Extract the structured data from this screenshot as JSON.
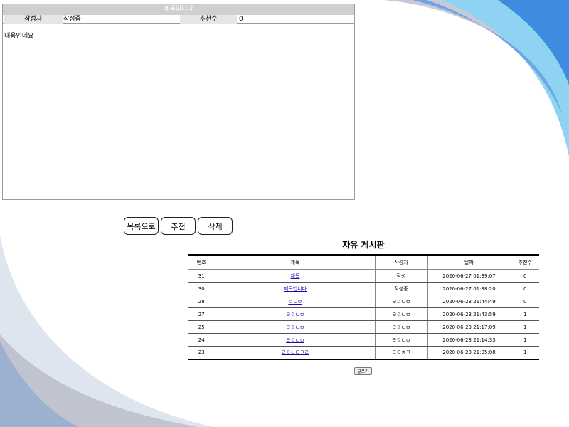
{
  "post": {
    "title": "제목입니다",
    "author_label": "작성자",
    "author": "작성중",
    "recommend_label": "추천수",
    "recommend_count": "0",
    "content": "내용인데요"
  },
  "actions": {
    "list": "목록으로",
    "recommend": "추천",
    "delete": "삭제"
  },
  "board": {
    "title": "자유 게시판",
    "headers": [
      "번호",
      "제목",
      "작성자",
      "날짜",
      "추천수"
    ],
    "rows": [
      {
        "no": "31",
        "title": "제목",
        "author": "작성",
        "date": "2020-06-27 01:39:07",
        "rec": "0"
      },
      {
        "no": "30",
        "title": "제목입니다",
        "author": "작성중",
        "date": "2020-06-27 01:38:20",
        "rec": "0"
      },
      {
        "no": "28",
        "title": "ㅇㄴㅁ",
        "author": "ㄹㅇㄴㅁ",
        "date": "2020-06-23 21:44:49",
        "rec": "0"
      },
      {
        "no": "27",
        "title": "ㄹㅇㄴㅁ",
        "author": "ㄹㅇㄴㅁ",
        "date": "2020-06-23 21:43:59",
        "rec": "1"
      },
      {
        "no": "25",
        "title": "ㄹㅇㄴㅁ",
        "author": "ㄹㅇㄴㅁ",
        "date": "2020-06-23 21:17:09",
        "rec": "1"
      },
      {
        "no": "24",
        "title": "ㄹㅇㄴㅁ",
        "author": "ㄹㅇㄴㅁ",
        "date": "2020-06-23 21:14:33",
        "rec": "1"
      },
      {
        "no": "23",
        "title": "ㄹㅇㄴㅌㅋㄹ",
        "author": "ㅌㅌㅊㅋ",
        "date": "2020-06-23 21:05:08",
        "rec": "1"
      }
    ],
    "write_label": "글쓰기"
  },
  "colors": {
    "wave_blue": "#4a90d9",
    "wave_light": "#8fc3f0",
    "wave_gray": "#b6bccc",
    "header_gray": "#cfcfcf"
  }
}
